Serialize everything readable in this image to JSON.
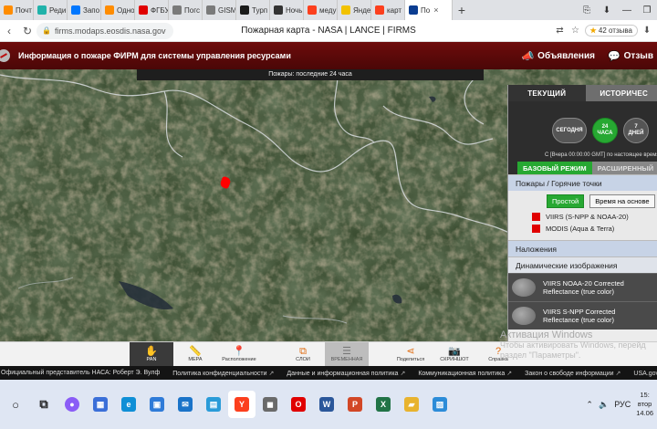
{
  "browser": {
    "tabs": [
      {
        "label": "Почт",
        "icon": "mail-icon",
        "color": "#ff8c00"
      },
      {
        "label": "Реди",
        "icon": "circle-icon",
        "color": "#20b2aa"
      },
      {
        "label": "Запо",
        "icon": "vk-icon",
        "color": "#0077ff"
      },
      {
        "label": "Одно",
        "icon": "ok-icon",
        "color": "#ff8c00"
      },
      {
        "label": "ФГБУ",
        "icon": "video-icon",
        "color": "#e00000"
      },
      {
        "label": "Погс",
        "icon": "doc-icon",
        "color": "#7a7a7a"
      },
      {
        "label": "GISM",
        "icon": "doc-icon",
        "color": "#7a7a7a"
      },
      {
        "label": "Турп",
        "icon": "tv-icon",
        "color": "#1a1a1a"
      },
      {
        "label": "Ночь",
        "icon": "moon-icon",
        "color": "#333333"
      },
      {
        "label": "меду",
        "icon": "yandex-icon",
        "color": "#fc3f1d"
      },
      {
        "label": "Янде",
        "icon": "star-icon",
        "color": "#f2c200"
      },
      {
        "label": "карт",
        "icon": "yandex-icon",
        "color": "#fc3f1d"
      },
      {
        "label": "По",
        "icon": "nasa-icon",
        "color": "#0b3d91",
        "active": true
      }
    ],
    "url": "firms.modaps.eosdis.nasa.gov",
    "page_title": "Пожарная карта - NASA | LANCE | FIRMS",
    "rating_star": "★",
    "rating": "42 отзыва"
  },
  "app": {
    "title": "Информация о пожаре ФИРМ для системы управления ресурсами",
    "announcements": "Объявления",
    "feedback": "Отзыв",
    "subbar": "Пожары: последние 24 часа"
  },
  "panel": {
    "tab_current": "ТЕКУЩИЙ",
    "tab_history": "ИСТОРИЧЕС",
    "time_today": "СЕГОДНЯ",
    "time_24": "24\nЧАСА",
    "time_7": "7\nДНЕЙ",
    "date_line": "С [Вчера 00:00:00 GMT] по настоящее время",
    "mode_basic": "БАЗОВЫЙ РЕЖИМ",
    "mode_advanced": "РАСШИРЕННЫЙ",
    "fires_section": "Пожары / Горячие точки",
    "filter_simple": "Простой",
    "filter_time": "Время на основе",
    "legend": [
      {
        "label": "VIIRS (S-NPP & NOAA-20)",
        "color": "#e00000"
      },
      {
        "label": "MODIS (Aqua & Terra)",
        "color": "#e00000"
      }
    ],
    "overlays_section": "Наложения",
    "dynamic_section": "Динамические изображения",
    "dynamic_items": [
      {
        "line1": "VIIRS NOAA-20 Corrected",
        "line2": "Reflectance (true color)"
      },
      {
        "line1": "VIIRS S-NPP Corrected",
        "line2": "Reflectance (true color)"
      }
    ]
  },
  "toolbar": [
    {
      "label": "PAN",
      "icon": "hand-icon",
      "glyph": "✋",
      "state": "active"
    },
    {
      "label": "МЕРА",
      "icon": "ruler-icon",
      "glyph": "📏",
      "state": "normal"
    },
    {
      "label": "Расположение",
      "icon": "location-icon",
      "glyph": "📍",
      "state": "normal"
    },
    {
      "label": "",
      "icon": "spacer",
      "glyph": "",
      "state": "spacer"
    },
    {
      "label": "СЛОИ",
      "icon": "layers-icon",
      "glyph": "⧉",
      "state": "normal"
    },
    {
      "label": "ВРЕМЕННАЯ",
      "icon": "timeline-icon",
      "glyph": "☰",
      "state": "greyed"
    },
    {
      "label": "",
      "icon": "spacer",
      "glyph": "",
      "state": "spacer"
    },
    {
      "label": "Поделиться",
      "icon": "share-icon",
      "glyph": "⋖",
      "state": "normal"
    },
    {
      "label": "СКРИНШОТ",
      "icon": "camera-icon",
      "glyph": "📷",
      "state": "normal"
    },
    {
      "label": "Справка",
      "icon": "help-icon",
      "glyph": "?",
      "state": "normal"
    }
  ],
  "watermark": {
    "title": "Активация Windows",
    "line1": "Чтобы активировать Windows, перейд",
    "line2": "раздел \"Параметры\"."
  },
  "footer_links": [
    {
      "label": "Официальный представитель НАСА: Роберт Э. Вулф",
      "external": false
    },
    {
      "label": "Политика конфиденциальности",
      "external": true
    },
    {
      "label": "Данные и информационная политика",
      "external": true
    },
    {
      "label": "Коммуникационная политика",
      "external": true
    },
    {
      "label": "Закон о свободе информации",
      "external": true
    },
    {
      "label": "USA.gov",
      "external": true
    }
  ],
  "taskbar": {
    "apps": [
      {
        "name": "start-icon",
        "glyph": "○",
        "color": "#222222"
      },
      {
        "name": "task-view-icon",
        "glyph": "⧉",
        "color": "#222222"
      },
      {
        "name": "alice-icon",
        "glyph": "●",
        "color": "#8a5cf6"
      },
      {
        "name": "calculator-icon",
        "glyph": "▦",
        "color": "#3b6fd8"
      },
      {
        "name": "edge-icon",
        "glyph": "e",
        "color": "#0f8fd6"
      },
      {
        "name": "store-icon",
        "glyph": "▣",
        "color": "#2f7bd8"
      },
      {
        "name": "mail-icon",
        "glyph": "✉",
        "color": "#1a73c8"
      },
      {
        "name": "photos-icon",
        "glyph": "▤",
        "color": "#2a9bd8"
      },
      {
        "name": "yandex-browser-icon",
        "glyph": "Y",
        "color": "#fc3f1d",
        "active": true
      },
      {
        "name": "media-icon",
        "glyph": "◼",
        "color": "#6a6a6a"
      },
      {
        "name": "opera-icon",
        "glyph": "O",
        "color": "#e00000"
      },
      {
        "name": "word-icon",
        "glyph": "W",
        "color": "#2b579a"
      },
      {
        "name": "powerpoint-icon",
        "glyph": "P",
        "color": "#d24726"
      },
      {
        "name": "excel-icon",
        "glyph": "X",
        "color": "#217346"
      },
      {
        "name": "explorer-icon",
        "glyph": "▰",
        "color": "#e8b32e"
      },
      {
        "name": "image-viewer-icon",
        "glyph": "▨",
        "color": "#2c8cd8"
      }
    ],
    "lang": "РУС",
    "time": "15:",
    "day": "втор",
    "date": "14.06"
  }
}
